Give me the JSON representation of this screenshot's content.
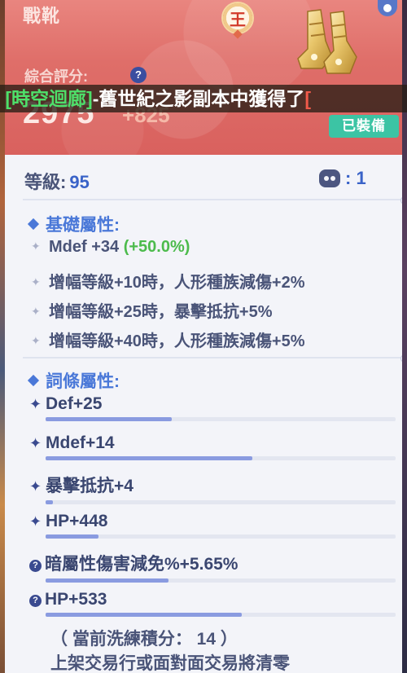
{
  "header": {
    "item_name": "戰靴",
    "king_badge": "王",
    "score_label": "綜合評分:",
    "score_value": "2975",
    "score_bonus": "+825",
    "equipped_label": "已裝備"
  },
  "ticker": {
    "part1": "[時空迴廊]",
    "part2": "-舊世紀之影副本中獲得了",
    "part3": "["
  },
  "level": {
    "label": "等級:",
    "value": "95",
    "slot_count": ": 1"
  },
  "basic_attrs": {
    "title": "基礎屬性:",
    "items": [
      {
        "text": "Mdef +34 ",
        "pct": "(+50.0%)"
      },
      {
        "text": "增幅等級+10時，人形種族減傷+2%"
      },
      {
        "text": "增幅等級+25時，暴擊抵抗+5%"
      },
      {
        "text": "增幅等級+40時，人形種族減傷+5%"
      }
    ]
  },
  "affixes": {
    "title": "詞條屬性:",
    "items": [
      {
        "text": "Def+25",
        "icon": "sparkle-icon",
        "fill": 0.36
      },
      {
        "text": "Mdef+14",
        "icon": "sparkle-icon",
        "fill": 0.59
      },
      {
        "text": "暴擊抵抗+4",
        "icon": "sparkle-icon",
        "fill": 0.02
      },
      {
        "text": "HP+448",
        "icon": "sparkle-icon",
        "fill": 0.15
      },
      {
        "text": "暗屬性傷害減免%+5.65%",
        "icon": "question-icon",
        "fill": 0.35
      },
      {
        "text": "HP+533",
        "icon": "question-icon",
        "fill": 0.56
      }
    ]
  },
  "footer": {
    "refine_score": "（ 當前洗練積分： 14 ）",
    "trade_note": "上架交易行或面對面交易將清零"
  },
  "colors": {
    "accent_blue": "#4a78d8",
    "header_red": "#df6e69",
    "equipped_green": "#3cc4a4",
    "bonus_green": "#4cbb4c"
  }
}
